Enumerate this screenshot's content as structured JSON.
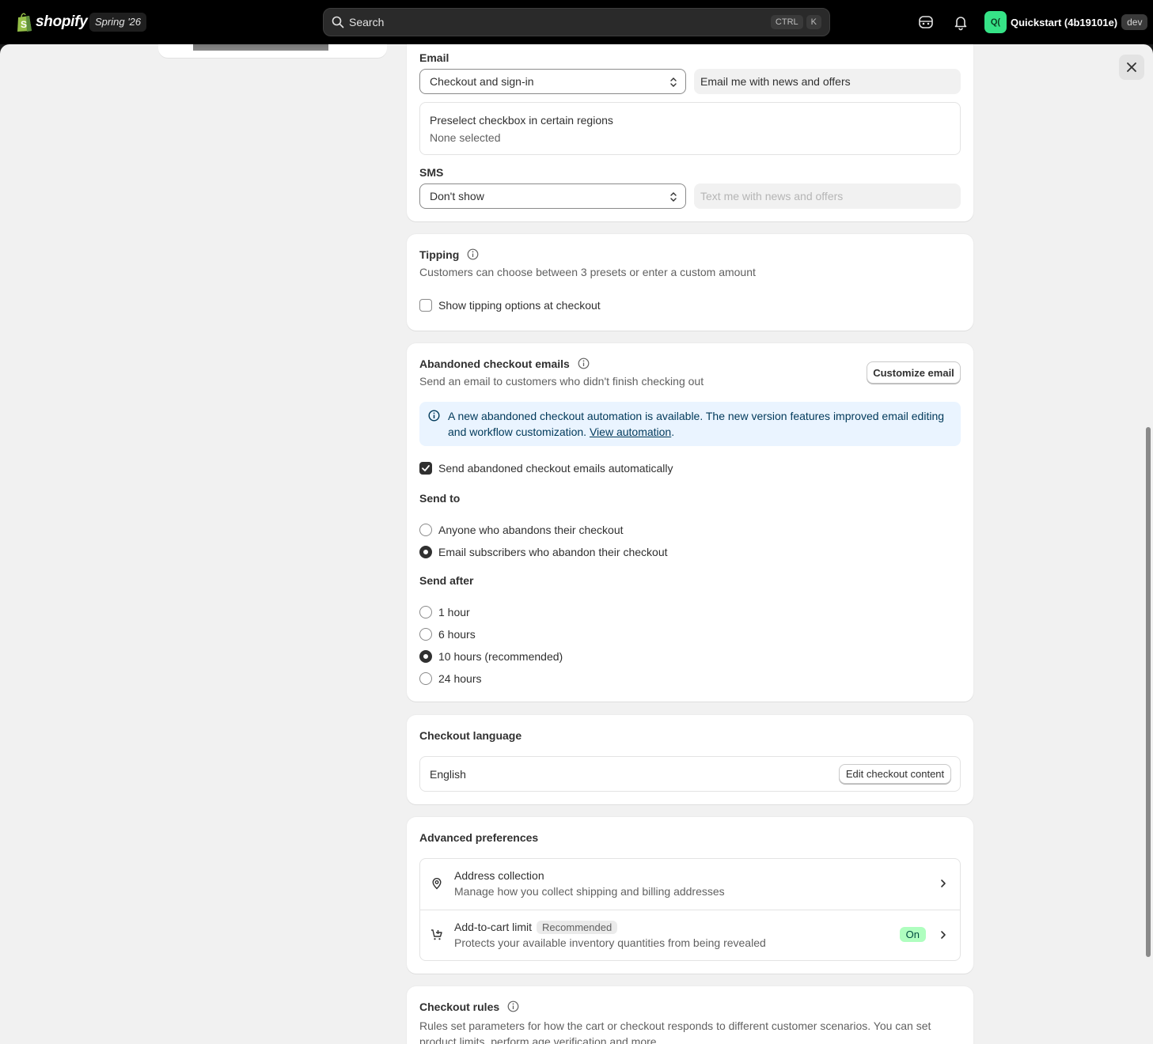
{
  "topbar": {
    "brand": "shopify",
    "edition": "Spring '26",
    "search_placeholder": "Search",
    "shortcut_ctrl": "CTRL",
    "shortcut_k": "K",
    "avatar_initials": "Q(",
    "store_name": "Quickstart (4b19101e)",
    "env_badge": "dev"
  },
  "marketing": {
    "email_heading": "Email",
    "email_select_value": "Checkout and sign-in",
    "email_optin_label": "Email me with news and offers",
    "preselect_title": "Preselect checkbox in certain regions",
    "preselect_value": "None selected",
    "sms_heading": "SMS",
    "sms_select_value": "Don't show",
    "sms_optin_label": "Text me with news and offers"
  },
  "tipping": {
    "title": "Tipping",
    "description": "Customers can choose between 3 presets or enter a custom amount",
    "checkbox_label": "Show tipping options at checkout",
    "checked": false
  },
  "abandoned": {
    "title": "Abandoned checkout emails",
    "description": "Send an email to customers who didn't finish checking out",
    "customize_button": "Customize email",
    "banner_text": "A new abandoned checkout automation is available. The new version features improved email editing and workflow customization.",
    "banner_link": "View automation",
    "banner_period": ".",
    "auto_checkbox_label": "Send abandoned checkout emails automatically",
    "auto_checked": true,
    "send_to_heading": "Send to",
    "send_to_options": [
      "Anyone who abandons their checkout",
      "Email subscribers who abandon their checkout"
    ],
    "send_to_selected": 1,
    "send_after_heading": "Send after",
    "send_after_options": [
      "1 hour",
      "6 hours",
      "10 hours (recommended)",
      "24 hours"
    ],
    "send_after_selected": 2
  },
  "language": {
    "title": "Checkout language",
    "value": "English",
    "edit_button": "Edit checkout content"
  },
  "advanced": {
    "title": "Advanced preferences",
    "address_title": "Address collection",
    "address_desc": "Manage how you collect shipping and billing addresses",
    "cart_title": "Add-to-cart limit",
    "cart_badge": "Recommended",
    "cart_desc": "Protects your available inventory quantities from being revealed",
    "cart_status": "On"
  },
  "rules": {
    "title": "Checkout rules",
    "description": "Rules set parameters for how the cart or checkout responds to different customer scenarios. You can set product limits, perform age verification and more."
  },
  "colors": {
    "topbar_bg": "#000000",
    "canvas_bg": "#f1f1f1",
    "banner_bg": "#eaf4ff",
    "on_badge_bg": "#affebf",
    "avatar_bg": "#36e387"
  }
}
